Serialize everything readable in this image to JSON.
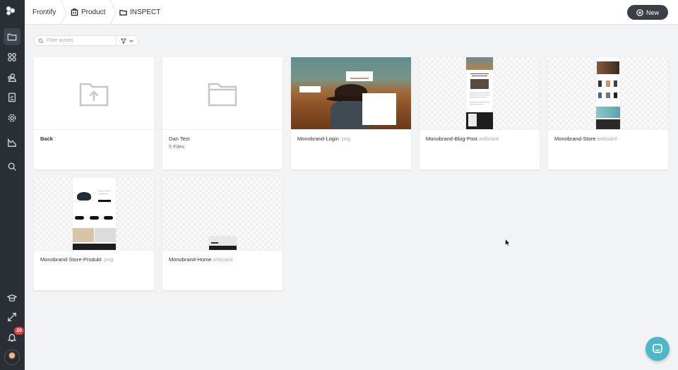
{
  "breadcrumb": {
    "items": [
      {
        "label": "Frontify"
      },
      {
        "label": "Product",
        "icon": "building-icon"
      },
      {
        "label": "INSPECT",
        "icon": "folder-icon"
      }
    ]
  },
  "header": {
    "new_label": "New"
  },
  "search": {
    "placeholder": "Filter assets"
  },
  "sidebar": {
    "items": [
      "folder-icon",
      "components-icon",
      "people-icon",
      "checklist-icon",
      "gear-icon",
      "analytics-icon",
      "search-icon"
    ],
    "bottom": [
      "academy-icon",
      "expand-icon",
      "bell-icon",
      "avatar"
    ],
    "notifications": "20"
  },
  "assets": [
    {
      "name": "Back",
      "ext": "",
      "meta": "",
      "kind": "back-folder"
    },
    {
      "name": "Dan Test",
      "ext": "",
      "meta": "5 Files",
      "kind": "folder"
    },
    {
      "name": "Monobrand-Login",
      "ext": ".png",
      "meta": "",
      "kind": "image"
    },
    {
      "name": "Monobrand-Blog-Post",
      "ext": "artboard",
      "meta": "",
      "kind": "artboard"
    },
    {
      "name": "Monobrand-Store",
      "ext": "artboard",
      "meta": "",
      "kind": "artboard"
    },
    {
      "name": "Monobrand-Store-Produkt",
      "ext": ".png",
      "meta": "",
      "kind": "image"
    },
    {
      "name": "Monobrand-Home",
      "ext": "artboard",
      "meta": "",
      "kind": "artboard"
    }
  ],
  "colors": {
    "rail": "#2a2f36",
    "accent_button": "#3a3f46",
    "chat": "#4bb7c8",
    "badge": "#e3413c"
  }
}
